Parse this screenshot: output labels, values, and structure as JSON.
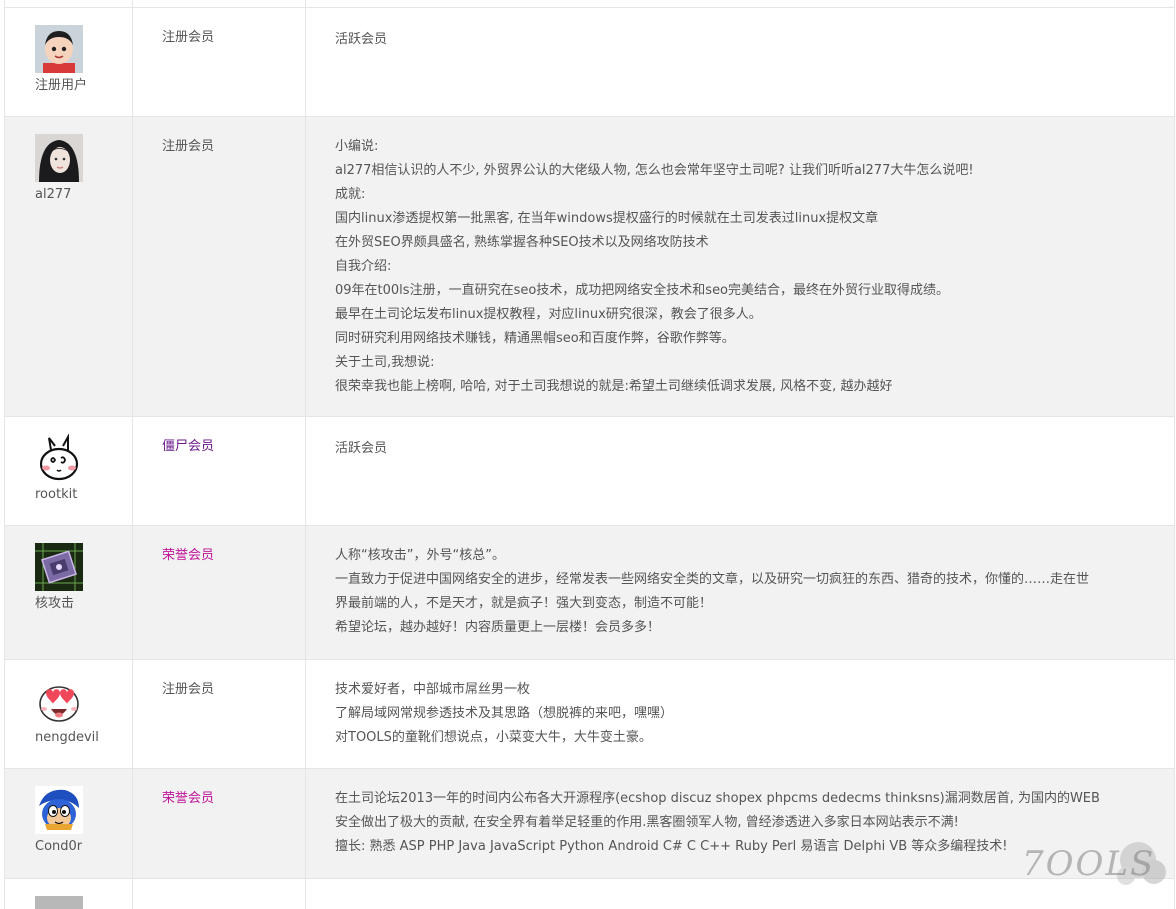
{
  "colors": {
    "group_registered": "#555555",
    "group_zombie": "#6a1b8c",
    "group_honor": "#c0139a",
    "row_alt_bg": "#f2f2f2",
    "border": "#e5e5e5"
  },
  "members": [
    {
      "username": "注册用户",
      "group": "注册会员",
      "group_color": "#555555",
      "avatar": "cartoon-boy-avatar",
      "desc": [
        "活跃会员"
      ]
    },
    {
      "username": "al277",
      "group": "注册会员",
      "group_color": "#555555",
      "avatar": "girl-photo-avatar",
      "desc": [
        "小编说:",
        "al277相信认识的人不少, 外贸界公认的大佬级人物, 怎么也会常年坚守土司呢? 让我们听听al277大牛怎么说吧!",
        "成就:",
        "国内linux渗透提权第一批黑客, 在当年windows提权盛行的时候就在土司发表过linux提权文章",
        "在外贸SEO界颇具盛名, 熟练掌握各种SEO技术以及网络攻防技术",
        "自我介绍:",
        "09年在t00ls注册，一直研究在seo技术，成功把网络安全技术和seo完美结合，最终在外贸行业取得成绩。",
        "最早在土司论坛发布linux提权教程，对应linux研究很深，教会了很多人。",
        "同时研究利用网络技术赚钱，精通黑帽seo和百度作弊，谷歌作弊等。",
        "关于土司,我想说:",
        "很荣幸我也能上榜啊, 哈哈, 对于土司我想说的就是:希望土司继续低调求发展, 风格不变, 越办越好"
      ]
    },
    {
      "username": "rootkit",
      "group": "僵尸会员",
      "group_color": "#6a1b8c",
      "avatar": "rabbit-doodle-avatar",
      "desc": [
        "活跃会员"
      ]
    },
    {
      "username": "核攻击",
      "group": "荣誉会员",
      "group_color": "#c0139a",
      "avatar": "chip-avatar",
      "desc": [
        "人称“核攻击”，外号“核总”。",
        "一直致力于促进中国网络安全的进步，经常发表一些网络安全类的文章，以及研究一切疯狂的东西、猎奇的技术，你懂的……走在世",
        "界最前端的人，不是天才，就是疯子！强大到变态，制造不可能！",
        "希望论坛，越办越好！内容质量更上一层楼！会员多多！"
      ]
    },
    {
      "username": "nengdevil",
      "group": "注册会员",
      "group_color": "#555555",
      "avatar": "heart-eyes-avatar",
      "desc": [
        "技术爱好者，中部城市屌丝男一枚",
        "了解局域网常规参透技术及其思路（想脱裤的来吧，嘿嘿）",
        "对TOOLS的童靴们想说点，小菜变大牛，大牛变土豪。"
      ]
    },
    {
      "username": "Cond0r",
      "group": "荣誉会员",
      "group_color": "#c0139a",
      "avatar": "sonic-avatar",
      "desc": [
        "在土司论坛2013一年的时间内公布各大开源程序(ecshop discuz shopex phpcms dedecms thinksns)漏洞数居首, 为国内的WEB",
        "安全做出了极大的贡献, 在安全界有着举足轻重的作用.黑客圈领军人物, 曾经渗透进入多家日本网站表示不满!",
        "擅长: 熟悉 ASP PHP Java JavaScript Python Android C# C C++ Ruby Perl 易语言 Delphi VB 等众多编程技术!"
      ]
    }
  ],
  "watermark": {
    "text": "7OOLS",
    "icon": "t00ls-watermark-logo"
  }
}
